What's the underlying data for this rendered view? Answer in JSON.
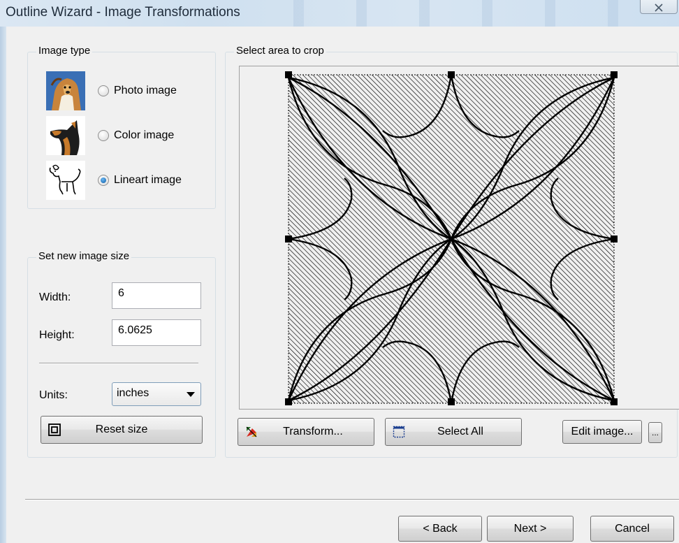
{
  "window": {
    "title": "Outline Wizard - Image Transformations",
    "close_glyph": "☒"
  },
  "image_type": {
    "legend": "Image type",
    "options": [
      {
        "label": "Photo image",
        "icon": "collie-photo-icon",
        "selected": false
      },
      {
        "label": "Color image",
        "icon": "dog-color-icon",
        "selected": false
      },
      {
        "label": "Lineart image",
        "icon": "dog-lineart-icon",
        "selected": true
      }
    ]
  },
  "size": {
    "legend": "Set new image size",
    "width_label": "Width:",
    "width_value": "6",
    "height_label": "Height:",
    "height_value": "6.0625",
    "units_label": "Units:",
    "units_value": "inches",
    "reset_label": "Reset size"
  },
  "crop": {
    "legend": "Select area to crop",
    "transform_label": "Transform...",
    "select_all_label": "Select All",
    "edit_image_label": "Edit image...",
    "more_label": "..."
  },
  "nav": {
    "back_label": "< Back",
    "next_label": "Next >",
    "cancel_label": "Cancel"
  }
}
